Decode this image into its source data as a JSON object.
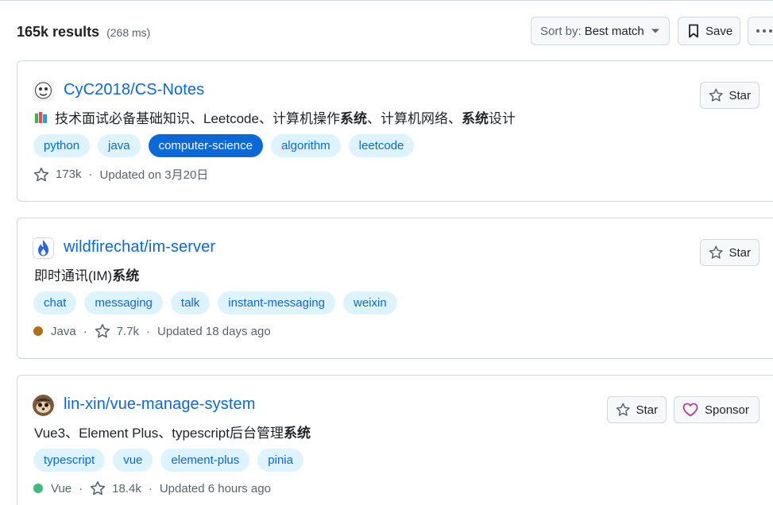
{
  "header": {
    "results_count": "165k results",
    "results_time": "(268 ms)",
    "sort_label": "Sort by:",
    "sort_value": "Best match",
    "save_label": "Save"
  },
  "repos": [
    {
      "name": "CyC2018/CS-Notes",
      "desc_parts": [
        "技术面试必备基础知识、Leetcode、计算机操作",
        "系统",
        "、计算机网络、",
        "系统",
        "设计"
      ],
      "topics": [
        "python",
        "java",
        "computer-science",
        "algorithm",
        "leetcode"
      ],
      "active_topic": "computer-science",
      "stars": "173k",
      "updated": "Updated on 3月20日",
      "star_label": "Star"
    },
    {
      "name": "wildfirechat/im-server",
      "desc_parts": [
        "即时通讯(IM)",
        "系统"
      ],
      "topics": [
        "chat",
        "messaging",
        "talk",
        "instant-messaging",
        "weixin"
      ],
      "language": "Java",
      "language_color": "#b07219",
      "stars": "7.7k",
      "updated": "Updated 18 days ago",
      "star_label": "Star"
    },
    {
      "name": "lin-xin/vue-manage-system",
      "desc_parts": [
        "Vue3、Element Plus、typescript后台管理",
        "系统"
      ],
      "topics": [
        "typescript",
        "vue",
        "element-plus",
        "pinia"
      ],
      "language": "Vue",
      "language_color": "#41b883",
      "stars": "18.4k",
      "updated": "Updated 6 hours ago",
      "star_label": "Star",
      "sponsor_label": "Sponsor"
    }
  ],
  "meta_separator": "·",
  "colors": {
    "link": "#0969da",
    "topic_bg": "#ddf4ff",
    "border": "#d0d7de",
    "muted": "#59636e",
    "sponsor_heart": "#bf3989"
  }
}
